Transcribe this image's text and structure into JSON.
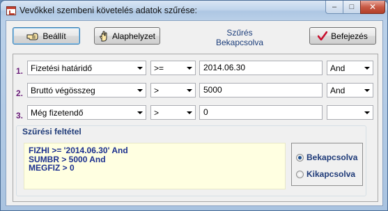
{
  "window": {
    "title": "Vevőkkel szembeni követelés adatok szűrése:",
    "controls": {
      "minimize": "–",
      "maximize": "□",
      "close": "✕"
    }
  },
  "toolbar": {
    "apply_label": "Beállít",
    "reset_label": "Alaphelyzet",
    "status_title": "Szűrés",
    "status_value": "Bekapcsolva",
    "finish_label": "Befejezés"
  },
  "filters": [
    {
      "num": "1.",
      "field": "Fizetési határidő",
      "operator": ">=",
      "value": "2014.06.30",
      "logic": "And"
    },
    {
      "num": "2.",
      "field": "Bruttó végösszeg",
      "operator": ">",
      "value": "5000",
      "logic": "And"
    },
    {
      "num": "3.",
      "field": "Még fizetendő",
      "operator": ">",
      "value": "0",
      "logic": ""
    }
  ],
  "filter_condition": {
    "title": "Szűrési feltétel",
    "lines": [
      "FIZHI >= '2014.06.30' And",
      "SUMBR > 5000 And",
      "MEGFIZ > 0"
    ]
  },
  "mode": {
    "on_label": "Bekapcsolva",
    "off_label": "Kikapcsolva",
    "selected": "on"
  },
  "colors": {
    "row_number": "#6b1e7a",
    "label_blue": "#1e3a78",
    "filter_text": "#1b2f8e",
    "filter_bg": "#ffffe1",
    "check_red": "#c8102e"
  }
}
